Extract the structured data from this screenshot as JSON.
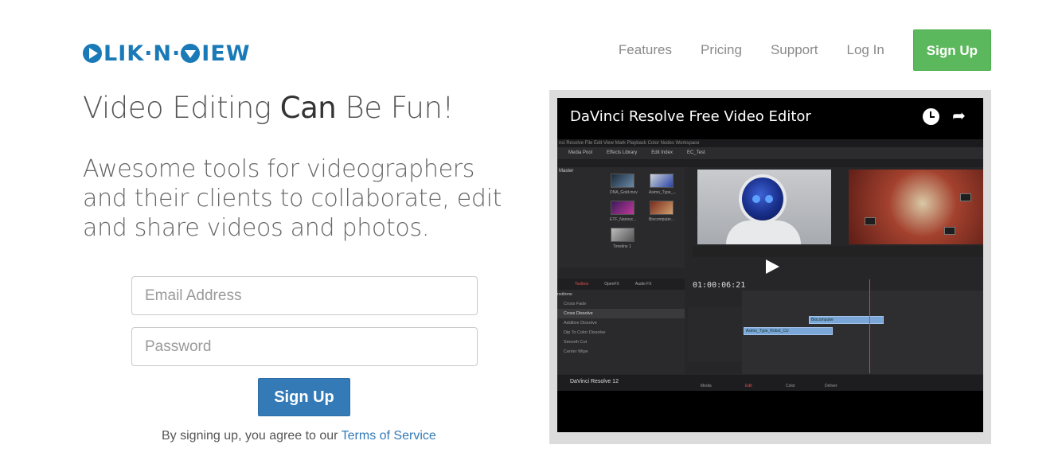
{
  "header": {
    "logo_text": "LIK·N·",
    "logo_text2": "IEW",
    "nav": {
      "features": "Features",
      "pricing": "Pricing",
      "support": "Support",
      "login": "Log In",
      "signup": "Sign Up"
    }
  },
  "hero": {
    "headline_part1": "Video Editing ",
    "headline_bold": "Can",
    "headline_part2": " Be Fun!",
    "subheadline": "Awesome tools for videographers and their clients to collaborate, edit and share videos and photos."
  },
  "form": {
    "email_placeholder": "Email Address",
    "password_placeholder": "Password",
    "submit_label": "Sign Up",
    "terms_prefix": "By signing up, you agree to our ",
    "terms_link": "Terms of Service"
  },
  "video": {
    "title": "DaVinci Resolve Free Video Editor",
    "app_menu": "nci Resolve   File   Edit   View   Mark   Playback   Color   Nodes   Workspace",
    "toolbar_media_pool": "Media Pool",
    "toolbar_effects": "Effects Library",
    "toolbar_edit_index": "Edit Index",
    "toolbar_project": "EC_Test",
    "pool_master": "Master",
    "thumbs": [
      "DNA_Gold.mov",
      "Asimo_Type_...",
      "ETF_Nanosc...",
      "Biocomputer...",
      "Timeline 1"
    ],
    "fx_tabs": [
      "Toolbox",
      "OpenFX",
      "Audio FX"
    ],
    "fx_items": [
      "nsitions",
      "Cross Fade",
      "Cross Dissolve",
      "Additive Dissolve",
      "Dip To Color Dissolve",
      "Smooth Cut",
      "Center Wipe"
    ],
    "timecode": "01:00:06:21",
    "clip_v1": "Asimo_Type_Robot_CU",
    "clip_v2": "Biocomputer",
    "app_name": "DaVinci Resolve 12",
    "bottom_tabs": [
      "Media",
      "Edit",
      "Color",
      "Deliver"
    ]
  }
}
